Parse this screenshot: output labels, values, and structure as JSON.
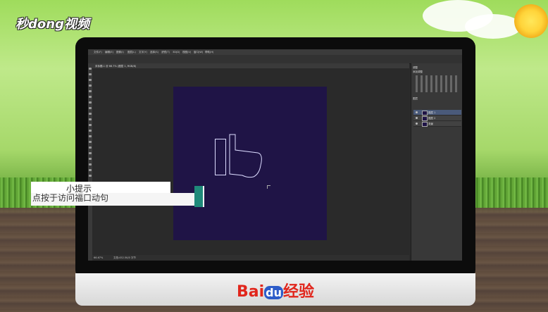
{
  "watermark": {
    "logo_text": "秒dong视频"
  },
  "photoshop": {
    "menu": [
      "文件(F)",
      "编辑(E)",
      "图像(I)",
      "图层(L)",
      "文字(Y)",
      "选择(S)",
      "滤镜(T)",
      "3D(D)",
      "视图(V)",
      "窗口(W)",
      "帮助(H)"
    ],
    "document_tab": "未标题-1 @ 66.7% (图层 1, RGB/8)",
    "status": {
      "zoom": "66.67%",
      "doc_info": "文档:452.5K/0 字节"
    },
    "panels": {
      "adjustments_title": "调整",
      "adjustments_subtitle": "添加调整",
      "layers_title": "图层",
      "layers": [
        {
          "name": "图层 1",
          "selected": true
        },
        {
          "name": "图层 2",
          "selected": false
        },
        {
          "name": "背景",
          "selected": false
        }
      ]
    }
  },
  "tip": {
    "title": "小提示",
    "body": "点按于访问福口动句"
  },
  "brand": {
    "bai": "Bai",
    "du": "du",
    "jingyan": "经验"
  }
}
